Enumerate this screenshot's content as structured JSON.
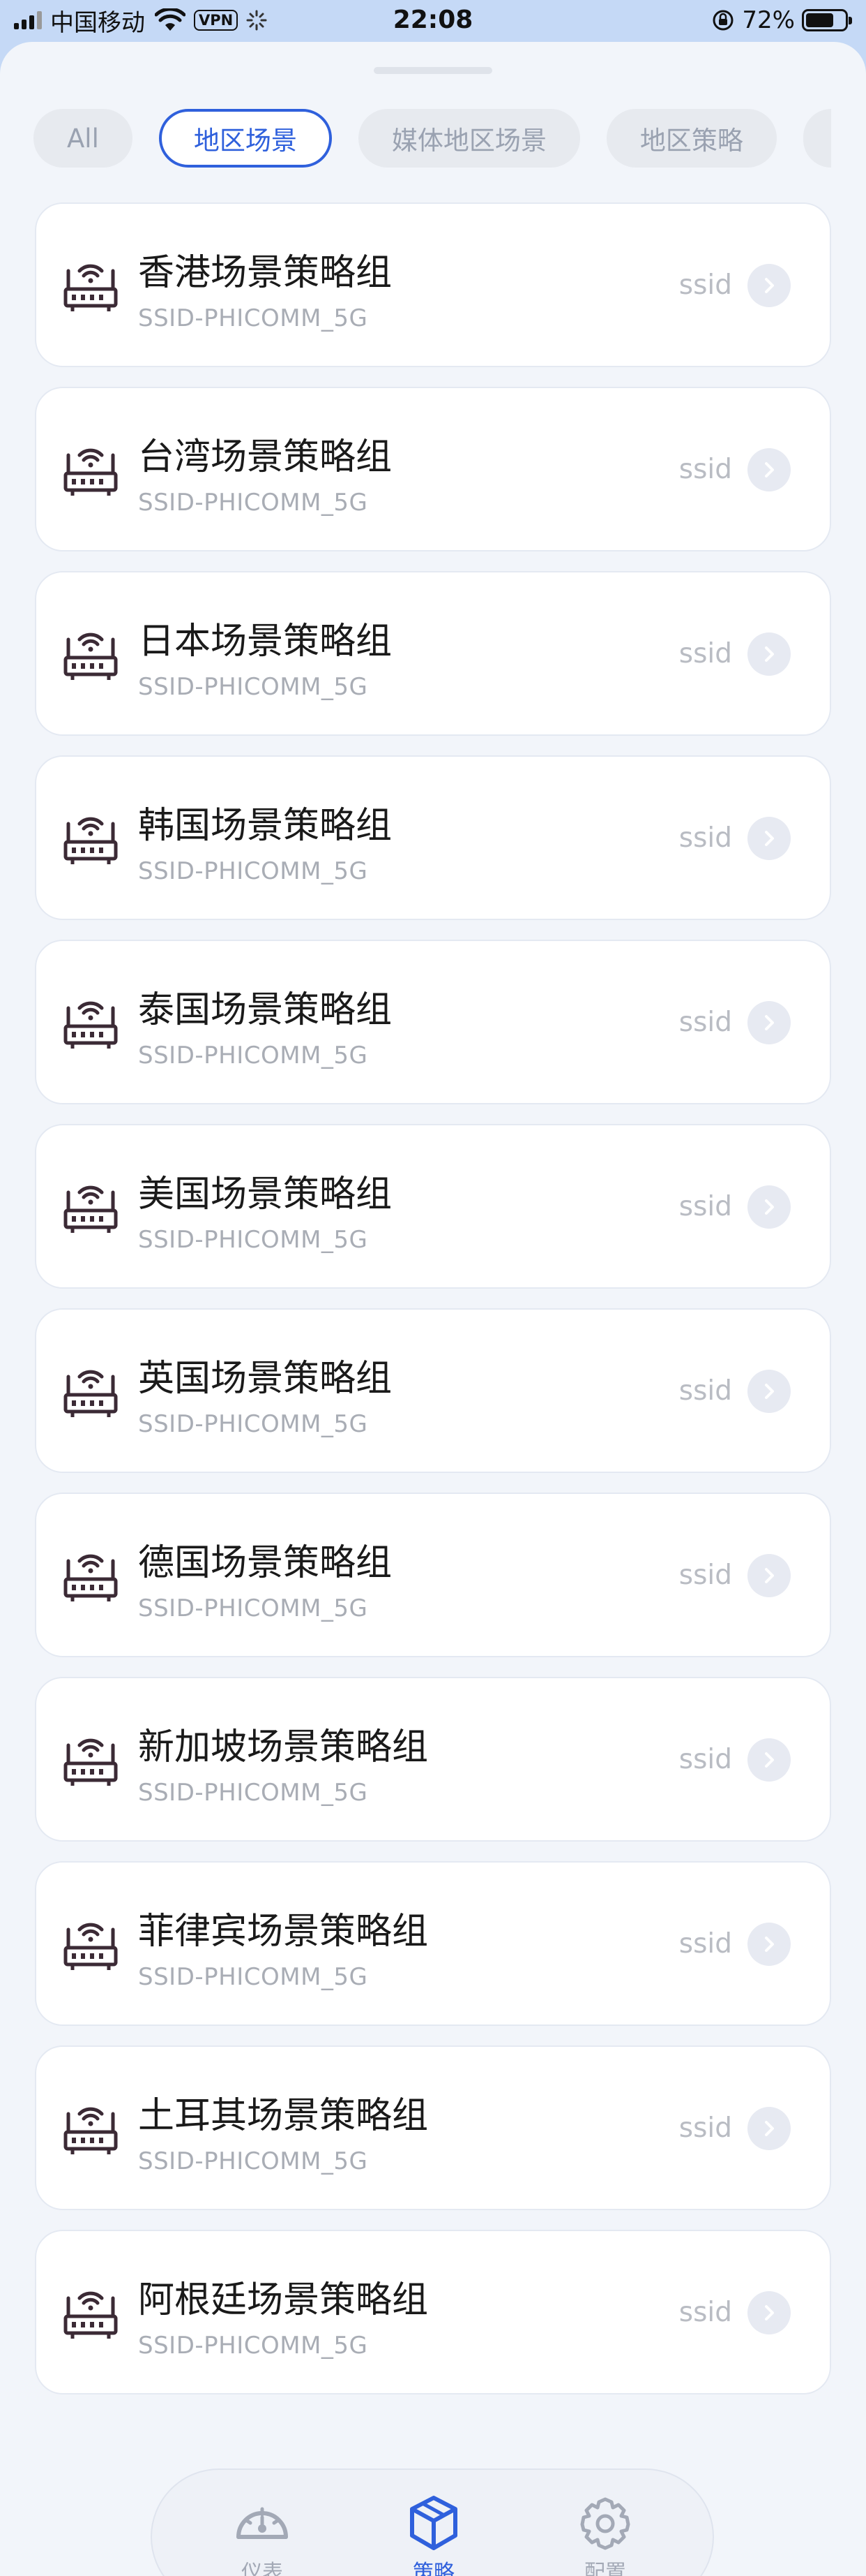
{
  "status_bar": {
    "carrier": "中国移动",
    "vpn": "VPN",
    "time": "22:08",
    "battery": "72%",
    "battery_level": 0.72
  },
  "tabs": [
    {
      "label": "All",
      "active": false
    },
    {
      "label": "地区场景",
      "active": true
    },
    {
      "label": "媒体地区场景",
      "active": false
    },
    {
      "label": "地区策略",
      "active": false
    }
  ],
  "items": [
    {
      "title": "香港场景策略组",
      "subtitle": "SSID-PHICOMM_5G",
      "tag": "ssid"
    },
    {
      "title": "台湾场景策略组",
      "subtitle": "SSID-PHICOMM_5G",
      "tag": "ssid"
    },
    {
      "title": "日本场景策略组",
      "subtitle": "SSID-PHICOMM_5G",
      "tag": "ssid"
    },
    {
      "title": "韩国场景策略组",
      "subtitle": "SSID-PHICOMM_5G",
      "tag": "ssid"
    },
    {
      "title": "泰国场景策略组",
      "subtitle": "SSID-PHICOMM_5G",
      "tag": "ssid"
    },
    {
      "title": "美国场景策略组",
      "subtitle": "SSID-PHICOMM_5G",
      "tag": "ssid"
    },
    {
      "title": "英国场景策略组",
      "subtitle": "SSID-PHICOMM_5G",
      "tag": "ssid"
    },
    {
      "title": "德国场景策略组",
      "subtitle": "SSID-PHICOMM_5G",
      "tag": "ssid"
    },
    {
      "title": "新加坡场景策略组",
      "subtitle": "SSID-PHICOMM_5G",
      "tag": "ssid"
    },
    {
      "title": "菲律宾场景策略组",
      "subtitle": "SSID-PHICOMM_5G",
      "tag": "ssid"
    },
    {
      "title": "土耳其场景策略组",
      "subtitle": "SSID-PHICOMM_5G",
      "tag": "ssid"
    },
    {
      "title": "阿根廷场景策略组",
      "subtitle": "SSID-PHICOMM_5G",
      "tag": "ssid"
    }
  ],
  "nav": [
    {
      "label": "仪表",
      "icon": "dashboard-gauge-icon",
      "active": false
    },
    {
      "label": "策略",
      "icon": "strategy-cube-icon",
      "active": true
    },
    {
      "label": "配置",
      "icon": "settings-gear-icon",
      "active": false
    }
  ],
  "colors": {
    "accent": "#2f60dc",
    "status_bar_bg": "#c5d9f6",
    "sheet_bg": "#f2f5fa",
    "router_icon": "#3b2a35"
  }
}
